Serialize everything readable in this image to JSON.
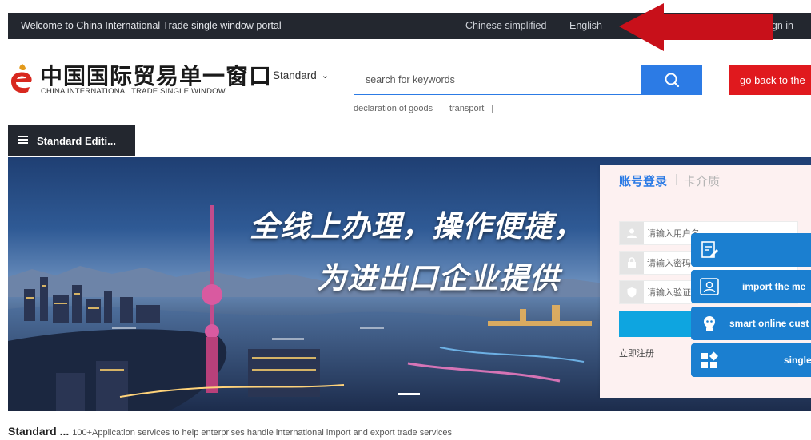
{
  "topbar": {
    "welcome": "Welcome to China International Trade single window portal",
    "lang_chinese": "Chinese simplified",
    "lang_english": "English",
    "sign_in": "gn in"
  },
  "header": {
    "logo_cn": "中国国际贸易单一窗口",
    "logo_en": "CHINA INTERNATIONAL TRADE SINGLE WINDOW",
    "edition_select": "Standard",
    "search_placeholder": "search for keywords",
    "go_back": "go back to the",
    "hot_keywords": [
      "declaration of goods",
      "transport"
    ]
  },
  "menu": {
    "label": "Standard Editi..."
  },
  "banner": {
    "slogan_line1": "全线上办理，操作便捷，",
    "slogan_line2": "为进出口企业提供"
  },
  "login": {
    "tab_account": "账号登录",
    "tab_separator": "|",
    "tab_card": "卡介质",
    "username_placeholder": "请输入用户名",
    "password_placeholder": "请输入密码",
    "captcha_placeholder": "请输入验证",
    "register": "立即注册"
  },
  "side_services": [
    {
      "label": "",
      "icon": "form-edit-icon"
    },
    {
      "label": "import the me",
      "icon": "contact-card-icon"
    },
    {
      "label": "smart online cust",
      "icon": "robot-icon"
    },
    {
      "label": "single",
      "icon": "apps-grid-icon"
    }
  ],
  "intro": {
    "title": "Standard ...",
    "description": "100+Application services to help enterprises handle international import and export trade services"
  },
  "colors": {
    "topbar_bg": "#23272f",
    "search_blue": "#2c7be5",
    "goback_red": "#e0191e",
    "sidetab_blue": "#1b7fd0",
    "annotation_arrow": "#c8101a"
  }
}
